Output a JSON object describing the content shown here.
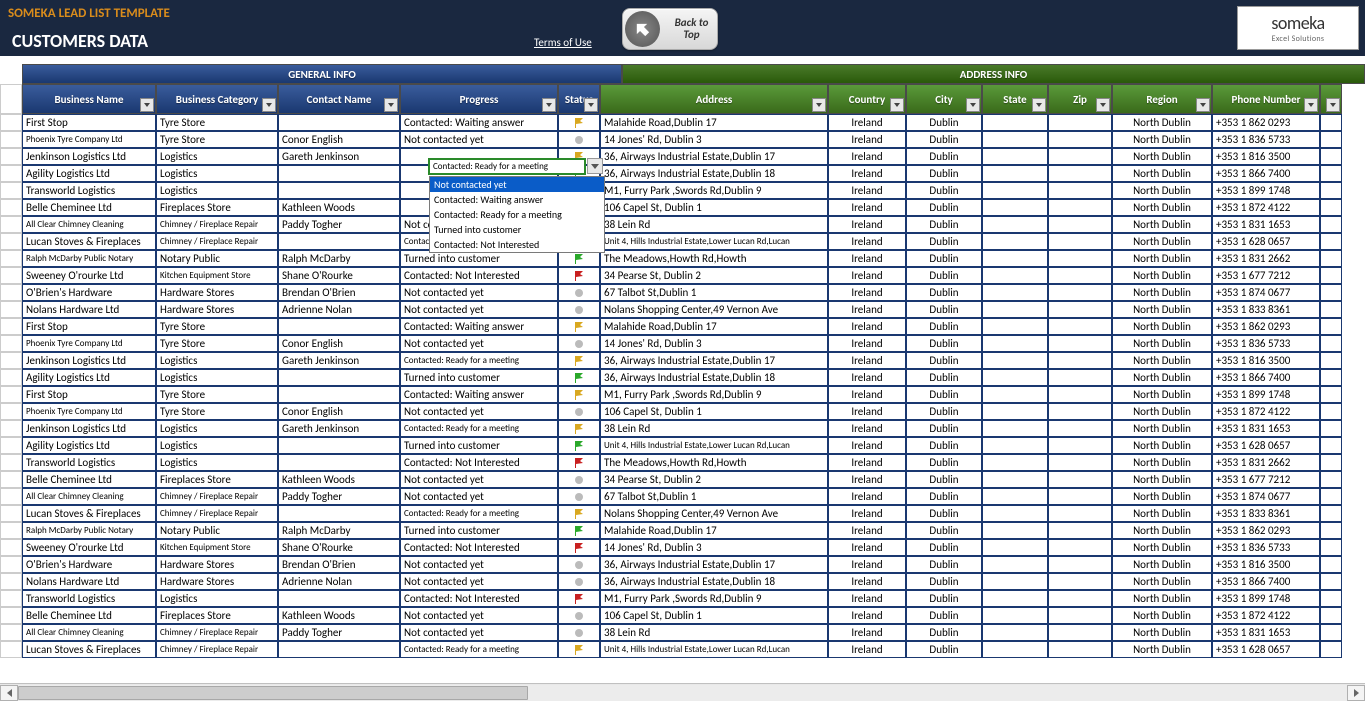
{
  "header": {
    "template_title": "SOMEKA LEAD LIST TEMPLATE",
    "section_title": "CUSTOMERS DATA",
    "terms": "Terms of Use",
    "back_to_top": "Back to Top",
    "logo_name": "someka",
    "logo_sub": "Excel Solutions"
  },
  "groups": {
    "general": "GENERAL INFO",
    "address": "ADDRESS INFO"
  },
  "columns": {
    "business_name": "Business Name",
    "business_category": "Business Category",
    "contact_name": "Contact Name",
    "progress": "Progress",
    "status": "Status",
    "address": "Address",
    "country": "Country",
    "city": "City",
    "state": "State",
    "zip": "Zip",
    "region": "Region",
    "phone": "Phone Number"
  },
  "dropdown": {
    "editing_value": "Contacted: Ready for a meeting",
    "items": [
      "Not contacted yet",
      "Contacted: Waiting answer",
      "Contacted: Ready for a meeting",
      "Turned into customer",
      "Contacted: Not Interested"
    ],
    "selected_index": 0
  },
  "rows": [
    {
      "bn": "First Stop",
      "bc": "Tyre Store",
      "cn": "",
      "pr": "Contacted: Waiting answer",
      "st": "yellow",
      "ad": "Malahide Road,Dublin 17",
      "co": "Ireland",
      "ci": "Dublin",
      "sta": "",
      "zip": "",
      "re": "North Dublin",
      "ph": "+353 1 862 0293"
    },
    {
      "bn": "Phoenix Tyre Company Ltd",
      "bc": "Tyre Store",
      "cn": "Conor English",
      "pr": "Not contacted yet",
      "st": "gray",
      "ad": "14 Jones' Rd, Dublin 3",
      "co": "Ireland",
      "ci": "Dublin",
      "sta": "",
      "zip": "",
      "re": "North Dublin",
      "ph": "+353 1 836 5733",
      "bn_small": true
    },
    {
      "bn": "Jenkinson Logistics Ltd",
      "bc": "Logistics",
      "cn": "Gareth Jenkinson",
      "pr": "",
      "st": "yellow",
      "ad": "36, Airways Industrial Estate,Dublin 17",
      "co": "Ireland",
      "ci": "Dublin",
      "sta": "",
      "zip": "",
      "re": "North Dublin",
      "ph": "+353 1 816 3500"
    },
    {
      "bn": "Agility Logistics Ltd",
      "bc": "Logistics",
      "cn": "",
      "pr": "",
      "st": "green",
      "ad": "36, Airways Industrial Estate,Dublin 18",
      "co": "Ireland",
      "ci": "Dublin",
      "sta": "",
      "zip": "",
      "re": "North Dublin",
      "ph": "+353 1 866 7400"
    },
    {
      "bn": "Transworld Logistics",
      "bc": "Logistics",
      "cn": "",
      "pr": "",
      "st": "red",
      "ad": "M1, Furry Park ,Swords Rd,Dublin 9",
      "co": "Ireland",
      "ci": "Dublin",
      "sta": "",
      "zip": "",
      "re": "North Dublin",
      "ph": "+353 1 899 1748"
    },
    {
      "bn": "Belle Cheminee Ltd",
      "bc": "Fireplaces Store",
      "cn": "Kathleen Woods",
      "pr": "",
      "st": "gray",
      "ad": "106 Capel St, Dublin 1",
      "co": "Ireland",
      "ci": "Dublin",
      "sta": "",
      "zip": "",
      "re": "North Dublin",
      "ph": "+353 1 872 4122"
    },
    {
      "bn": "All Clear Chimney Cleaning",
      "bc": "Chimney / Fireplace Repair",
      "cn": "Paddy Togher",
      "pr": "Not contacted yet",
      "st": "gray",
      "ad": "38 Lein Rd",
      "co": "Ireland",
      "ci": "Dublin",
      "sta": "",
      "zip": "",
      "re": "North Dublin",
      "ph": "+353 1 831 1653",
      "bn_small": true,
      "bc_small": true
    },
    {
      "bn": "Lucan Stoves & Fireplaces",
      "bc": "Chimney / Fireplace Repair",
      "cn": "",
      "pr": "Contacted: Ready for a meeting",
      "st": "yellow",
      "ad": "Unit 4, Hills Industrial Estate,Lower Lucan Rd,Lucan",
      "co": "Ireland",
      "ci": "Dublin",
      "sta": "",
      "zip": "",
      "re": "North Dublin",
      "ph": "+353 1 628 0657",
      "bc_small": true,
      "pr_small": true,
      "ad_small": true
    },
    {
      "bn": "Ralph McDarby Public Notary",
      "bc": "Notary Public",
      "cn": "Ralph McDarby",
      "pr": "Turned into customer",
      "st": "green",
      "ad": "The Meadows,Howth Rd,Howth",
      "co": "Ireland",
      "ci": "Dublin",
      "sta": "",
      "zip": "",
      "re": "North Dublin",
      "ph": "+353 1 831 2662",
      "bn_small": true
    },
    {
      "bn": "Sweeney O'rourke Ltd",
      "bc": "Kitchen Equipment Store",
      "cn": "Shane O'Rourke",
      "pr": "Contacted: Not Interested",
      "st": "red",
      "ad": "34 Pearse St, Dublin 2",
      "co": "Ireland",
      "ci": "Dublin",
      "sta": "",
      "zip": "",
      "re": "North Dublin",
      "ph": "+353 1 677 7212",
      "bc_small": true
    },
    {
      "bn": "O'Brien's Hardware",
      "bc": "Hardware Stores",
      "cn": "Brendan O'Brien",
      "pr": "Not contacted yet",
      "st": "gray",
      "ad": "67 Talbot St,Dublin 1",
      "co": "Ireland",
      "ci": "Dublin",
      "sta": "",
      "zip": "",
      "re": "North Dublin",
      "ph": "+353 1 874 0677"
    },
    {
      "bn": "Nolans Hardware Ltd",
      "bc": "Hardware Stores",
      "cn": "Adrienne Nolan",
      "pr": "Not contacted yet",
      "st": "gray",
      "ad": "Nolans Shopping Center,49 Vernon Ave",
      "co": "Ireland",
      "ci": "Dublin",
      "sta": "",
      "zip": "",
      "re": "North Dublin",
      "ph": "+353 1 833 8361"
    },
    {
      "bn": "First Stop",
      "bc": "Tyre Store",
      "cn": "",
      "pr": "Contacted: Waiting answer",
      "st": "yellow",
      "ad": "Malahide Road,Dublin 17",
      "co": "Ireland",
      "ci": "Dublin",
      "sta": "",
      "zip": "",
      "re": "North Dublin",
      "ph": "+353 1 862 0293"
    },
    {
      "bn": "Phoenix Tyre Company Ltd",
      "bc": "Tyre Store",
      "cn": "Conor English",
      "pr": "Not contacted yet",
      "st": "gray",
      "ad": "14 Jones' Rd, Dublin 3",
      "co": "Ireland",
      "ci": "Dublin",
      "sta": "",
      "zip": "",
      "re": "North Dublin",
      "ph": "+353 1 836 5733",
      "bn_small": true
    },
    {
      "bn": "Jenkinson Logistics Ltd",
      "bc": "Logistics",
      "cn": "Gareth Jenkinson",
      "pr": "Contacted: Ready for a meeting",
      "st": "yellow",
      "ad": "36, Airways Industrial Estate,Dublin 17",
      "co": "Ireland",
      "ci": "Dublin",
      "sta": "",
      "zip": "",
      "re": "North Dublin",
      "ph": "+353 1 816 3500",
      "pr_small": true
    },
    {
      "bn": "Agility Logistics Ltd",
      "bc": "Logistics",
      "cn": "",
      "pr": "Turned into customer",
      "st": "green",
      "ad": "36, Airways Industrial Estate,Dublin 18",
      "co": "Ireland",
      "ci": "Dublin",
      "sta": "",
      "zip": "",
      "re": "North Dublin",
      "ph": "+353 1 866 7400"
    },
    {
      "bn": "First Stop",
      "bc": "Tyre Store",
      "cn": "",
      "pr": "Contacted: Waiting answer",
      "st": "yellow",
      "ad": "M1, Furry Park ,Swords Rd,Dublin 9",
      "co": "Ireland",
      "ci": "Dublin",
      "sta": "",
      "zip": "",
      "re": "North Dublin",
      "ph": "+353 1 899 1748"
    },
    {
      "bn": "Phoenix Tyre Company Ltd",
      "bc": "Tyre Store",
      "cn": "Conor English",
      "pr": "Not contacted yet",
      "st": "gray",
      "ad": "106 Capel St, Dublin 1",
      "co": "Ireland",
      "ci": "Dublin",
      "sta": "",
      "zip": "",
      "re": "North Dublin",
      "ph": "+353 1 872 4122",
      "bn_small": true
    },
    {
      "bn": "Jenkinson Logistics Ltd",
      "bc": "Logistics",
      "cn": "Gareth Jenkinson",
      "pr": "Contacted: Ready for a meeting",
      "st": "yellow",
      "ad": "38 Lein Rd",
      "co": "Ireland",
      "ci": "Dublin",
      "sta": "",
      "zip": "",
      "re": "North Dublin",
      "ph": "+353 1 831 1653",
      "pr_small": true
    },
    {
      "bn": "Agility Logistics Ltd",
      "bc": "Logistics",
      "cn": "",
      "pr": "Turned into customer",
      "st": "green",
      "ad": "Unit 4, Hills Industrial Estate,Lower Lucan Rd,Lucan",
      "co": "Ireland",
      "ci": "Dublin",
      "sta": "",
      "zip": "",
      "re": "North Dublin",
      "ph": "+353 1 628 0657",
      "ad_small": true
    },
    {
      "bn": "Transworld Logistics",
      "bc": "Logistics",
      "cn": "",
      "pr": "Contacted: Not Interested",
      "st": "red",
      "ad": "The Meadows,Howth Rd,Howth",
      "co": "Ireland",
      "ci": "Dublin",
      "sta": "",
      "zip": "",
      "re": "North Dublin",
      "ph": "+353 1 831 2662"
    },
    {
      "bn": "Belle Cheminee Ltd",
      "bc": "Fireplaces Store",
      "cn": "Kathleen Woods",
      "pr": "Not contacted yet",
      "st": "gray",
      "ad": "34 Pearse St, Dublin 2",
      "co": "Ireland",
      "ci": "Dublin",
      "sta": "",
      "zip": "",
      "re": "North Dublin",
      "ph": "+353 1 677 7212"
    },
    {
      "bn": "All Clear Chimney Cleaning",
      "bc": "Chimney / Fireplace Repair",
      "cn": "Paddy Togher",
      "pr": "Not contacted yet",
      "st": "gray",
      "ad": "67 Talbot St,Dublin 1",
      "co": "Ireland",
      "ci": "Dublin",
      "sta": "",
      "zip": "",
      "re": "North Dublin",
      "ph": "+353 1 874 0677",
      "bn_small": true,
      "bc_small": true
    },
    {
      "bn": "Lucan Stoves & Fireplaces",
      "bc": "Chimney / Fireplace Repair",
      "cn": "",
      "pr": "Contacted: Ready for a meeting",
      "st": "yellow",
      "ad": "Nolans Shopping Center,49 Vernon Ave",
      "co": "Ireland",
      "ci": "Dublin",
      "sta": "",
      "zip": "",
      "re": "North Dublin",
      "ph": "+353 1 833 8361",
      "bc_small": true,
      "pr_small": true
    },
    {
      "bn": "Ralph McDarby Public Notary",
      "bc": "Notary Public",
      "cn": "Ralph McDarby",
      "pr": "Turned into customer",
      "st": "green",
      "ad": "Malahide Road,Dublin 17",
      "co": "Ireland",
      "ci": "Dublin",
      "sta": "",
      "zip": "",
      "re": "North Dublin",
      "ph": "+353 1 862 0293",
      "bn_small": true
    },
    {
      "bn": "Sweeney O'rourke Ltd",
      "bc": "Kitchen Equipment Store",
      "cn": "Shane O'Rourke",
      "pr": "Contacted: Not Interested",
      "st": "red",
      "ad": "14 Jones' Rd, Dublin 3",
      "co": "Ireland",
      "ci": "Dublin",
      "sta": "",
      "zip": "",
      "re": "North Dublin",
      "ph": "+353 1 836 5733",
      "bc_small": true
    },
    {
      "bn": "O'Brien's Hardware",
      "bc": "Hardware Stores",
      "cn": "Brendan O'Brien",
      "pr": "Not contacted yet",
      "st": "gray",
      "ad": "36, Airways Industrial Estate,Dublin 17",
      "co": "Ireland",
      "ci": "Dublin",
      "sta": "",
      "zip": "",
      "re": "North Dublin",
      "ph": "+353 1 816 3500"
    },
    {
      "bn": "Nolans Hardware Ltd",
      "bc": "Hardware Stores",
      "cn": "Adrienne Nolan",
      "pr": "Not contacted yet",
      "st": "gray",
      "ad": "36, Airways Industrial Estate,Dublin 18",
      "co": "Ireland",
      "ci": "Dublin",
      "sta": "",
      "zip": "",
      "re": "North Dublin",
      "ph": "+353 1 866 7400"
    },
    {
      "bn": "Transworld Logistics",
      "bc": "Logistics",
      "cn": "",
      "pr": "Contacted: Not Interested",
      "st": "red",
      "ad": "M1, Furry Park ,Swords Rd,Dublin 9",
      "co": "Ireland",
      "ci": "Dublin",
      "sta": "",
      "zip": "",
      "re": "North Dublin",
      "ph": "+353 1 899 1748"
    },
    {
      "bn": "Belle Cheminee Ltd",
      "bc": "Fireplaces Store",
      "cn": "Kathleen Woods",
      "pr": "Not contacted yet",
      "st": "gray",
      "ad": "106 Capel St, Dublin 1",
      "co": "Ireland",
      "ci": "Dublin",
      "sta": "",
      "zip": "",
      "re": "North Dublin",
      "ph": "+353 1 872 4122"
    },
    {
      "bn": "All Clear Chimney Cleaning",
      "bc": "Chimney / Fireplace Repair",
      "cn": "Paddy Togher",
      "pr": "Not contacted yet",
      "st": "gray",
      "ad": "38 Lein Rd",
      "co": "Ireland",
      "ci": "Dublin",
      "sta": "",
      "zip": "",
      "re": "North Dublin",
      "ph": "+353 1 831 1653",
      "bn_small": true,
      "bc_small": true
    },
    {
      "bn": "Lucan Stoves & Fireplaces",
      "bc": "Chimney / Fireplace Repair",
      "cn": "",
      "pr": "Contacted: Ready for a meeting",
      "st": "yellow",
      "ad": "Unit 4, Hills Industrial Estate,Lower Lucan Rd,Lucan",
      "co": "Ireland",
      "ci": "Dublin",
      "sta": "",
      "zip": "",
      "re": "North Dublin",
      "ph": "+353 1 628 0657",
      "bc_small": true,
      "pr_small": true,
      "ad_small": true
    }
  ]
}
